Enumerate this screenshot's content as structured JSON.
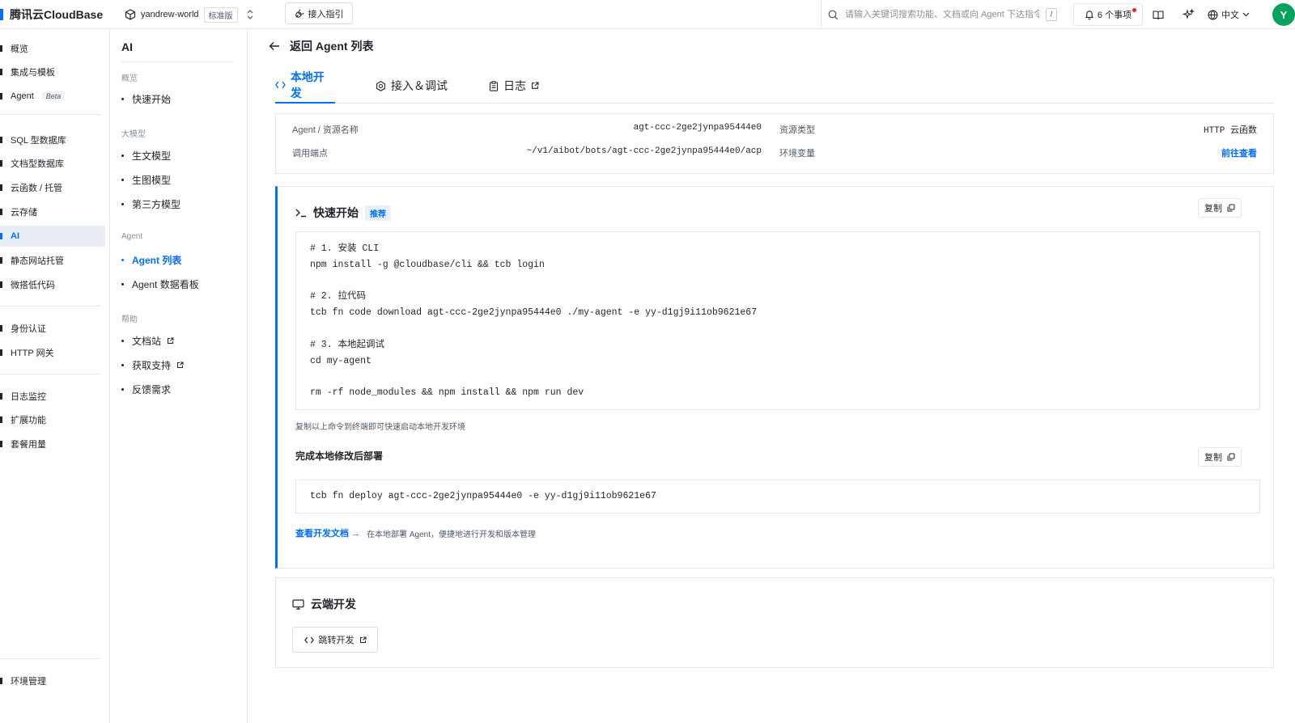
{
  "header": {
    "brand": "腾讯云CloudBase",
    "env_name": "yandrew-world",
    "env_badge": "标准版",
    "guide_label": "接入指引",
    "search_placeholder": "请输入关键词搜索功能、文档或向 Agent 下达指令",
    "search_shortcut": "/",
    "notifications_label": "6 个事项",
    "language_label": "中文",
    "avatar_initial": "Y"
  },
  "leftnav": {
    "items": [
      {
        "label": "概览"
      },
      {
        "label": "集成与模板"
      },
      {
        "label": "Agent",
        "badge": "Beta"
      },
      {
        "label": "SQL 型数据库"
      },
      {
        "label": "文档型数据库"
      },
      {
        "label": "云函数 / 托管"
      },
      {
        "label": "云存储"
      },
      {
        "label": "AI"
      },
      {
        "label": "静态网站托管"
      },
      {
        "label": "微搭低代码"
      },
      {
        "label": "身份认证"
      },
      {
        "label": "HTTP 网关"
      },
      {
        "label": "日志监控"
      },
      {
        "label": "扩展功能"
      },
      {
        "label": "套餐用量"
      },
      {
        "label": "环境管理"
      }
    ]
  },
  "subnav": {
    "title": "AI",
    "groups": [
      {
        "label": "概览",
        "items": [
          {
            "label": "快速开始"
          }
        ]
      },
      {
        "label": "大模型",
        "items": [
          {
            "label": "生文模型"
          },
          {
            "label": "生图模型"
          },
          {
            "label": "第三方模型"
          }
        ]
      },
      {
        "label": "Agent",
        "items": [
          {
            "label": "Agent 列表"
          },
          {
            "label": "Agent 数据看板"
          }
        ]
      },
      {
        "label": "帮助",
        "items": [
          {
            "label": "文档站"
          },
          {
            "label": "获取支持"
          },
          {
            "label": "反馈需求"
          }
        ]
      }
    ]
  },
  "main": {
    "back_label": "返回 Agent 列表",
    "tabs": [
      {
        "label": "本地开发"
      },
      {
        "label": "接入＆调试"
      },
      {
        "label": "日志"
      }
    ],
    "info": {
      "name_label": "Agent / 资源名称",
      "name_value": "agt-ccc-2ge2jynpa95444e0",
      "type_label": "资源类型",
      "type_value": "HTTP 云函数",
      "endpoint_label": "调用端点",
      "endpoint_value": "~/v1/aibot/bots/agt-ccc-2ge2jynpa95444e0/acp",
      "envvar_label": "环境变量",
      "envvar_link": "前往查看"
    },
    "quickstart": {
      "title": "快速开始",
      "badge": "推荐",
      "copy_label": "复制",
      "code": [
        "# 1. 安装 CLI",
        "npm install -g @cloudbase/cli && tcb login",
        "",
        "# 2. 拉代码",
        "tcb fn code download agt-ccc-2ge2jynpa95444e0 ./my-agent -e yy-d1gj9i11ob9621e67",
        "",
        "# 3. 本地起调试",
        "cd my-agent",
        "",
        "rm -rf node_modules && npm install && npm run dev"
      ],
      "hint": "复制以上命令到终端即可快速启动本地开发环境",
      "deploy_title": "完成本地修改后部署",
      "deploy_copy_label": "复制",
      "deploy_code": "tcb fn deploy agt-ccc-2ge2jynpa95444e0 -e yy-d1gj9i11ob9621e67",
      "doc_link": "查看开发文档 →",
      "doc_desc": "在本地部署 Agent，便捷地进行开发和版本管理"
    },
    "cloud": {
      "title": "云端开发",
      "jump_label": "跳转开发"
    }
  },
  "colors": {
    "accent": "#006eff",
    "avatar": "#07a35a",
    "notification_dot": "#f5222d"
  }
}
